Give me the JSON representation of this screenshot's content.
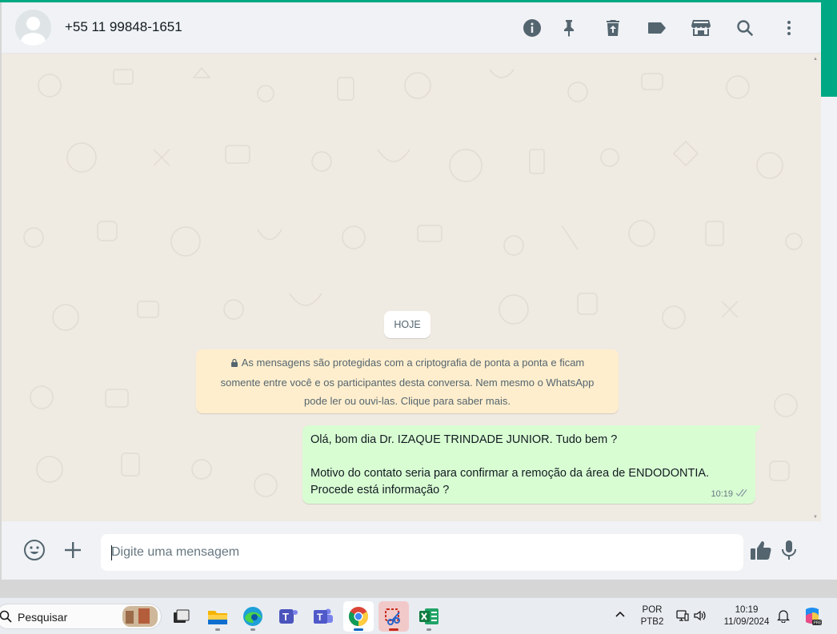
{
  "header": {
    "contact_name": "+55 11 99848-1651",
    "icons": [
      "info-icon",
      "pin-icon",
      "delete-icon",
      "label-icon",
      "catalog-icon",
      "search-icon",
      "menu-icon"
    ]
  },
  "chat": {
    "date_separator": "HOJE",
    "encryption_notice": {
      "line1": "As mensagens são protegidas com a criptografia de ponta a ponta e ficam",
      "line2": "somente entre você e os participantes desta conversa. Nem mesmo o WhatsApp",
      "line3": "pode ler ou ouvi-las. Clique para saber mais."
    },
    "messages": [
      {
        "direction": "outgoing",
        "line1": "Olá, bom dia Dr.  IZAQUE TRINDADE JUNIOR. Tudo bem ?",
        "line2": "Motivo do contato seria para confirmar a remoção da área de ENDODONTIA.",
        "line3": "Procede está informação ?",
        "time": "10:19",
        "status": "read"
      }
    ]
  },
  "composer": {
    "placeholder": "Digite uma mensagem"
  },
  "taskbar": {
    "search_label": "Pesquisar",
    "apps": [
      "task-view",
      "file-explorer",
      "edge",
      "teams",
      "teams-classic",
      "chrome",
      "snipping-tool",
      "excel"
    ],
    "language": "POR",
    "keyboard": "PTB2",
    "clock_time": "10:19",
    "clock_date": "11/09/2024",
    "colors": {
      "whatsapp_green": "#00a884",
      "outgoing_bubble": "#d9fdd3",
      "notice_bg": "#ffeecd"
    }
  }
}
